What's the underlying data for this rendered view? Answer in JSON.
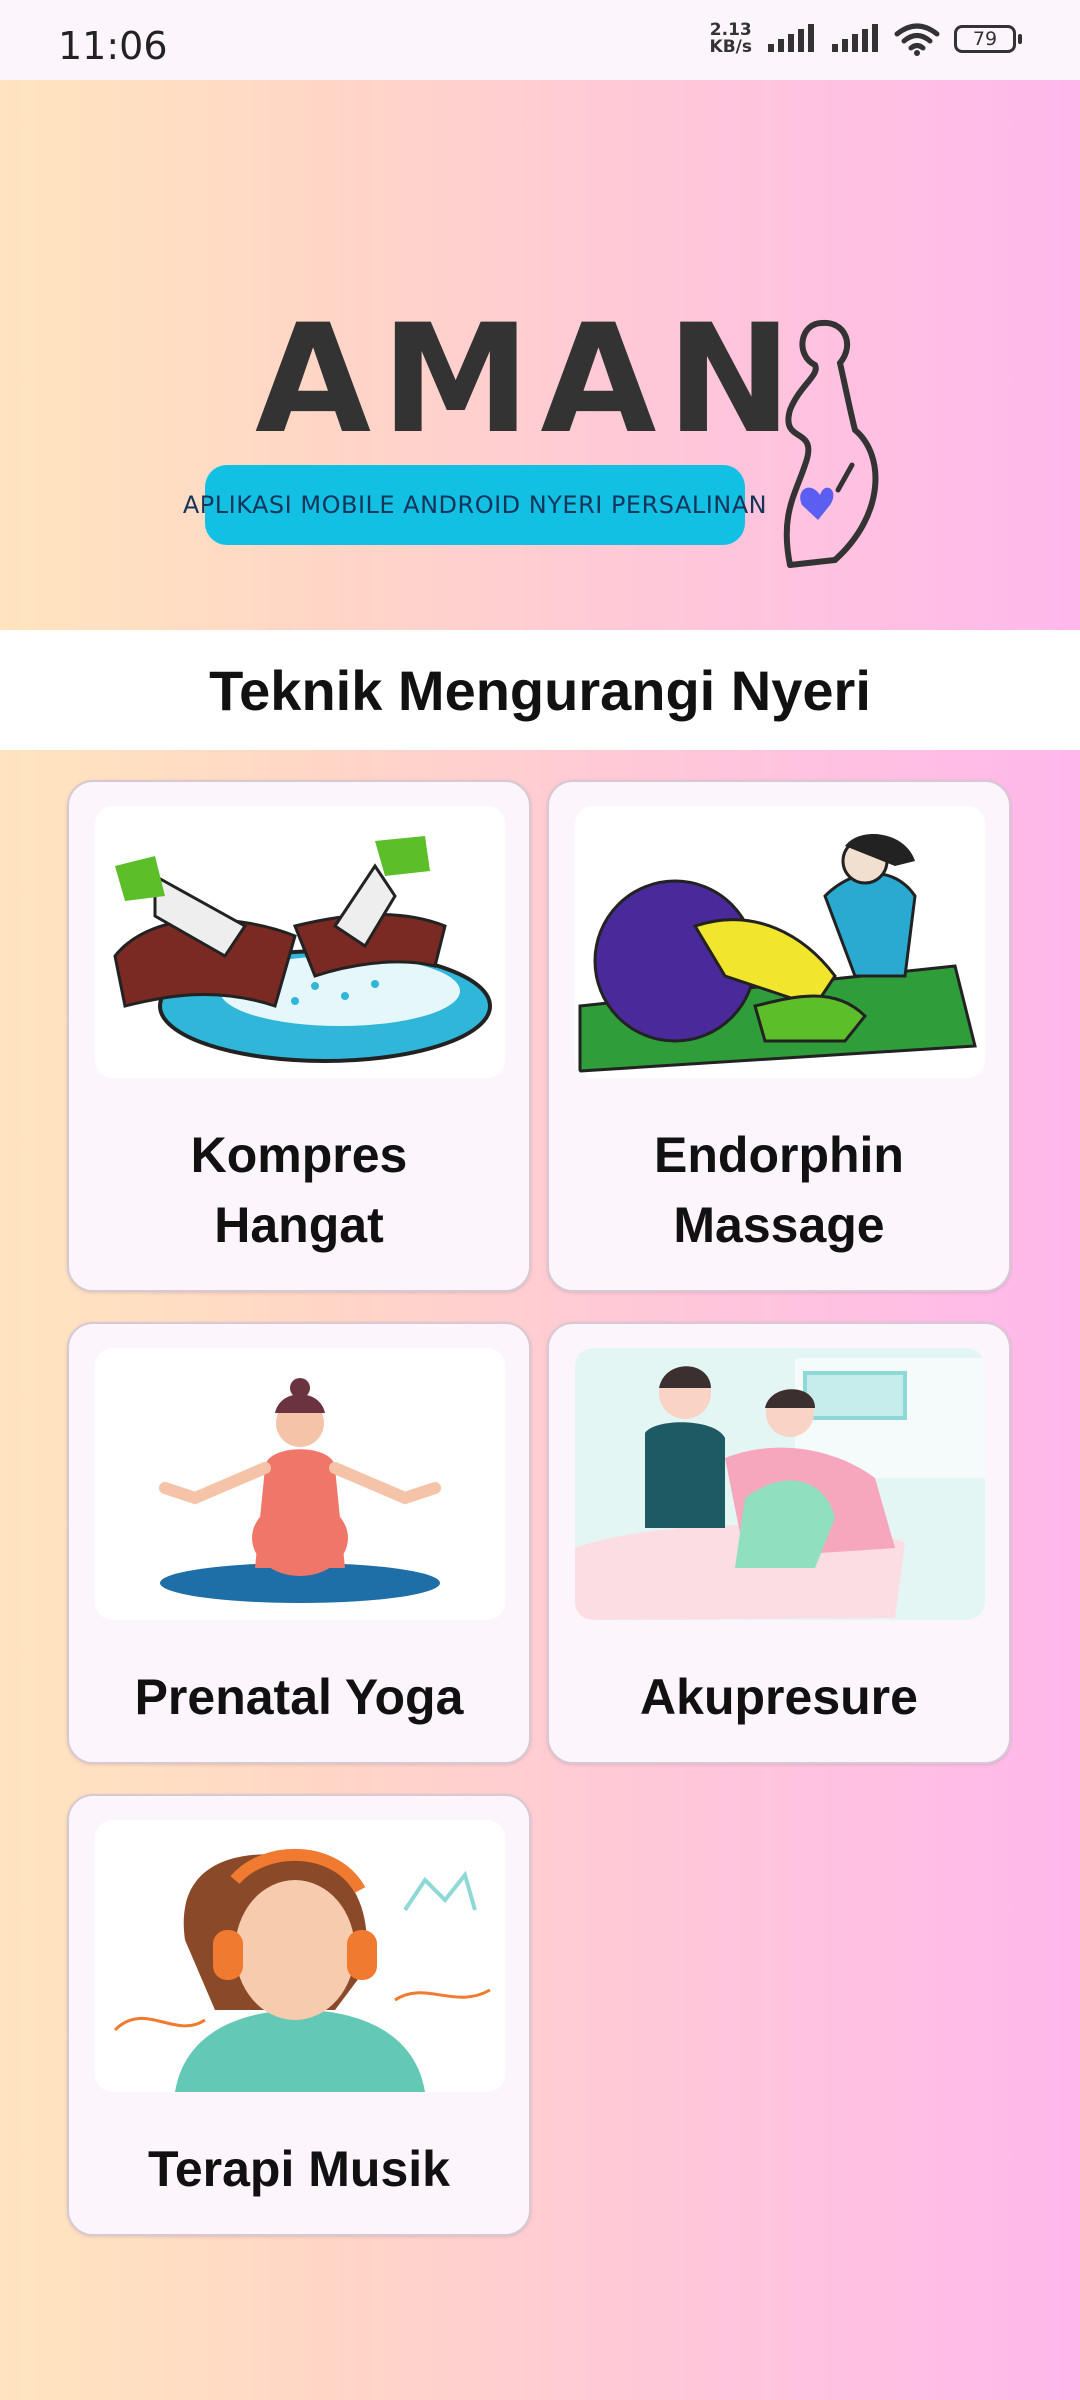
{
  "status_bar": {
    "time": "11:06",
    "net_speed_value": "2.13",
    "net_speed_unit": "KB/s",
    "battery": "79"
  },
  "logo": {
    "title": "AMAN",
    "subtitle": "APLIKASI MOBILE ANDROID NYERI PERSALINAN",
    "pill_color": "#12c0e3"
  },
  "section": {
    "title": "Teknik Mengurangi Nyeri"
  },
  "cards": [
    {
      "label_line1": "Kompres",
      "label_line2": "Hangat",
      "image": "warm-compress-illustration"
    },
    {
      "label_line1": "Endorphin",
      "label_line2": "Massage",
      "image": "massage-illustration"
    },
    {
      "label": "Prenatal Yoga",
      "image": "yoga-illustration"
    },
    {
      "label": "Akupresure",
      "image": "acupressure-illustration"
    },
    {
      "label": "Terapi Musik",
      "image": "music-therapy-illustration"
    }
  ]
}
